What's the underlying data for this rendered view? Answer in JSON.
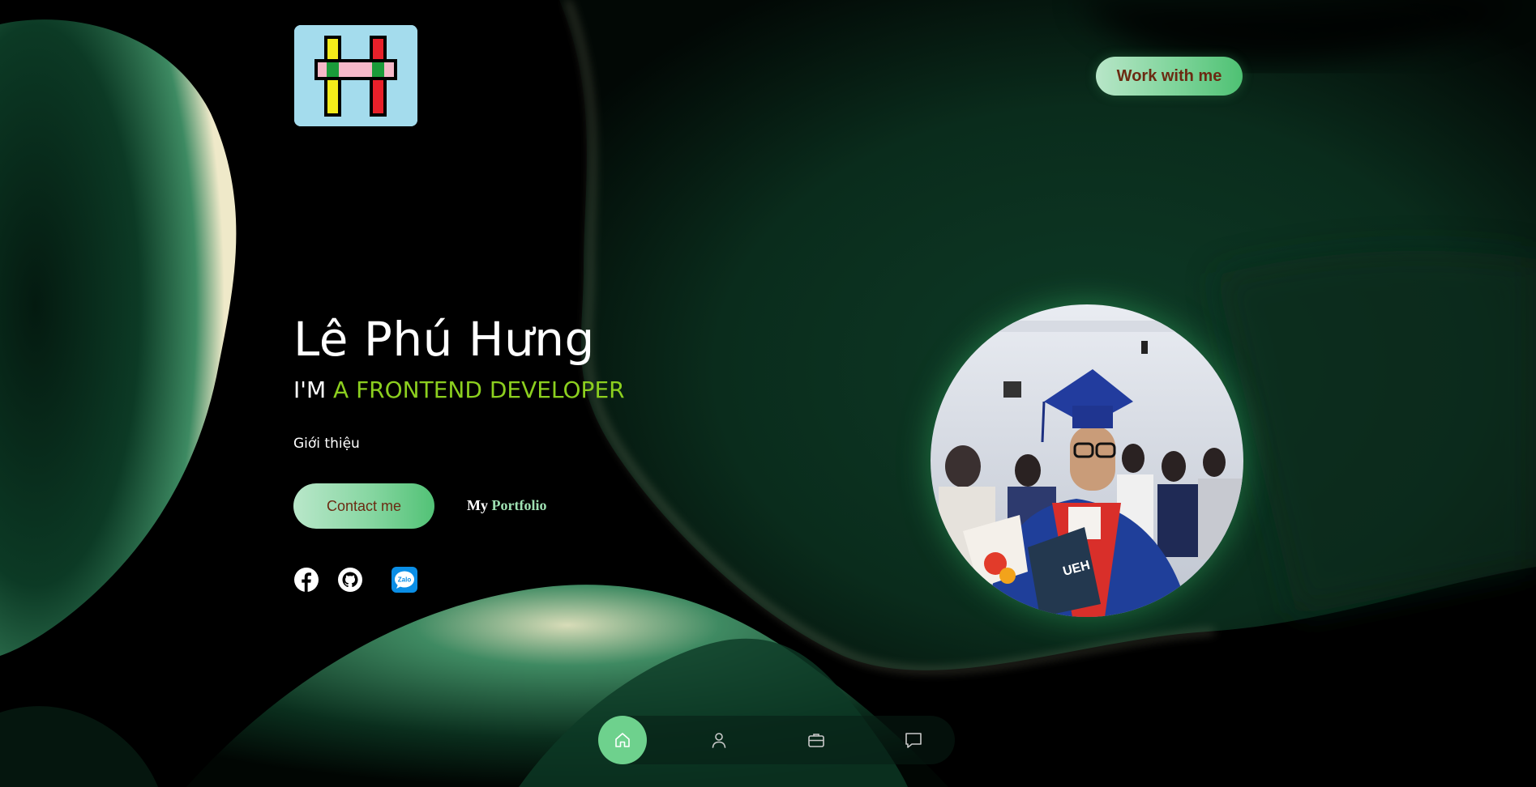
{
  "header": {
    "logo_icon": "h-logo-icon",
    "cta_label": "Work with me"
  },
  "hero": {
    "name": "Lê Phú Hưng",
    "role_prefix": "I'M ",
    "role_highlight": "A FRONTEND DEVELOPER",
    "intro_label": "Giới thiệu",
    "contact_label": "Contact me",
    "portfolio_label_1": "My ",
    "portfolio_label_2": "Portfolio"
  },
  "socials": [
    {
      "icon": "facebook-icon"
    },
    {
      "icon": "github-icon"
    },
    {
      "icon": "zalo-icon",
      "text": "Zalo"
    }
  ],
  "avatar": {
    "icon": "profile-photo",
    "badge_text": "UEH"
  },
  "bottom_nav": [
    {
      "icon": "home-icon",
      "active": true
    },
    {
      "icon": "user-icon",
      "active": false
    },
    {
      "icon": "briefcase-icon",
      "active": false
    },
    {
      "icon": "chat-icon",
      "active": false
    }
  ],
  "colors": {
    "accent_green": "#6ed18d",
    "role_highlight": "#8ccf1f",
    "button_text": "#6b2a12",
    "logo_bg": "#a4dced"
  }
}
